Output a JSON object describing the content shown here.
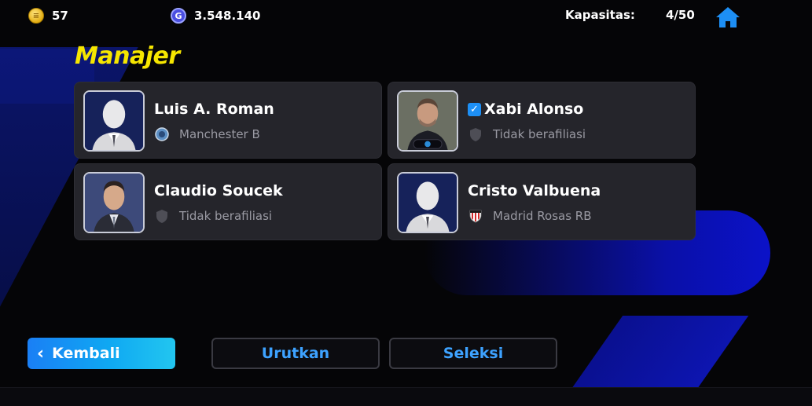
{
  "topbar": {
    "coins": "57",
    "gp": "3.548.140",
    "capacity_label": "Kapasitas:",
    "capacity_value": "4/50"
  },
  "title": "Manajer",
  "managers": [
    {
      "name": "Luis A. Roman",
      "club": "Manchester B",
      "verified": false,
      "portrait": "silhouette",
      "club_icon": "club-badge-blue"
    },
    {
      "name": "Xabi Alonso",
      "club": "Tidak berafiliasi",
      "verified": true,
      "portrait": "photo",
      "club_icon": "shield-gray"
    },
    {
      "name": "Claudio Soucek",
      "club": "Tidak berafiliasi",
      "verified": false,
      "portrait": "photo",
      "club_icon": "shield-gray"
    },
    {
      "name": "Cristo Valbuena",
      "club": "Madrid Rosas RB",
      "verified": false,
      "portrait": "silhouette",
      "club_icon": "club-badge-redwhite"
    }
  ],
  "buttons": {
    "back": "Kembali",
    "sort": "Urutkan",
    "select": "Seleksi"
  },
  "colors": {
    "title": "#f6e600",
    "accent_blue": "#1a7ff5",
    "outline_text": "#3da2ff",
    "card_bg": "#25252b"
  }
}
